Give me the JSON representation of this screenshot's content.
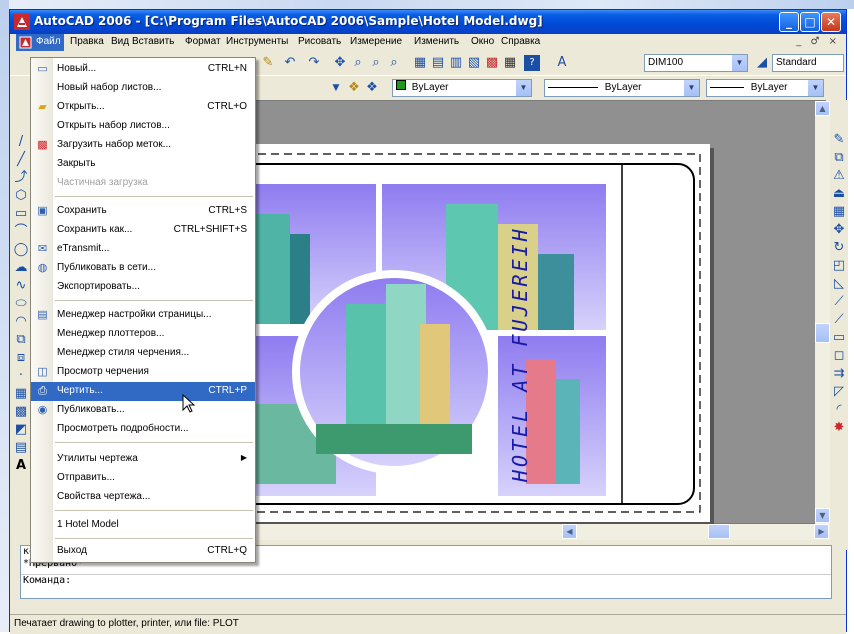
{
  "window": {
    "title": "AutoCAD 2006 - [C:\\Program Files\\AutoCAD 2006\\Sample\\Hotel Model.dwg]",
    "title_color": "#0049d6"
  },
  "menubar": {
    "items": [
      "Файл",
      "Правка",
      "Вид",
      "Вставить",
      "Формат",
      "Инструменты",
      "Рисовать",
      "Измерение",
      "Изменить",
      "Окно",
      "Справка"
    ],
    "active_color": "#316ac5",
    "mdi_controls": "_ ♂ ×"
  },
  "toolbar": {
    "dimstyle": "DIM100",
    "textstyle": "Standard",
    "layer_color": "ByLayer",
    "linetype": "ByLayer",
    "lineweight": "ByLayer"
  },
  "file_menu": {
    "items": [
      {
        "label": "Новый...",
        "shortcut": "CTRL+N",
        "icon": "new-file-icon"
      },
      {
        "label": "Новый набор листов...",
        "shortcut": "",
        "icon": ""
      },
      {
        "label": "Открыть...",
        "shortcut": "CTRL+O",
        "icon": "open-folder-icon"
      },
      {
        "label": "Открыть набор листов...",
        "shortcut": "",
        "icon": ""
      },
      {
        "label": "Загрузить набор меток...",
        "shortcut": "",
        "icon": "markup-icon"
      },
      {
        "label": "Закрыть",
        "shortcut": "",
        "icon": ""
      },
      {
        "label": "Частичная загрузка",
        "shortcut": "",
        "icon": "",
        "disabled": true
      },
      {
        "label": "Сохранить",
        "shortcut": "CTRL+S",
        "icon": "save-icon"
      },
      {
        "label": "Сохранить как...",
        "shortcut": "CTRL+SHIFT+S",
        "icon": ""
      },
      {
        "label": "eTransmit...",
        "shortcut": "",
        "icon": "etransmit-icon"
      },
      {
        "label": "Публиковать в сети...",
        "shortcut": "",
        "icon": "publish-web-icon"
      },
      {
        "label": "Экспортировать...",
        "shortcut": "",
        "icon": ""
      },
      {
        "label": "Менеджер настройки страницы...",
        "shortcut": "",
        "icon": "page-setup-icon"
      },
      {
        "label": "Менеджер плоттеров...",
        "shortcut": "",
        "icon": ""
      },
      {
        "label": "Менеджер стиля черчения...",
        "shortcut": "",
        "icon": ""
      },
      {
        "label": "Просмотр черчения",
        "shortcut": "",
        "icon": "plot-preview-icon"
      },
      {
        "label": "Чертить...",
        "shortcut": "CTRL+P",
        "icon": "plot-icon",
        "highlighted": true
      },
      {
        "label": "Публиковать...",
        "shortcut": "",
        "icon": "publish-icon"
      },
      {
        "label": "Просмотреть подробности...",
        "shortcut": "",
        "icon": ""
      },
      {
        "label": "Утилиты чертежа",
        "shortcut": "",
        "icon": "",
        "submenu": true
      },
      {
        "label": "Отправить...",
        "shortcut": "",
        "icon": ""
      },
      {
        "label": "Свойства чертежа...",
        "shortcut": "",
        "icon": ""
      },
      {
        "label": "1 Hotel Model",
        "shortcut": "",
        "icon": ""
      },
      {
        "label": "Выход",
        "shortcut": "CTRL+Q",
        "icon": ""
      }
    ],
    "highlight_color": "#316ac5"
  },
  "drawing": {
    "title_block_text": "HOTEL AT FUJEREIH",
    "title_text_color": "#1a1aa6"
  },
  "command": {
    "lines": [
      "комплексного меню.",
      "*Прервано*"
    ],
    "prompt": "Команда:"
  },
  "statusbar": {
    "text": "Печатает drawing to plotter, printer, или file:  PLOT"
  }
}
